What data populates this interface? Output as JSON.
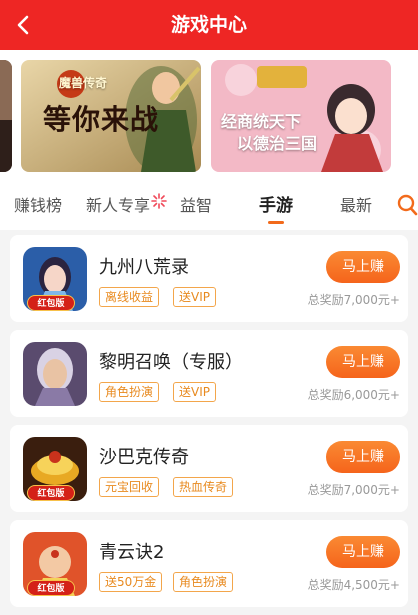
{
  "header": {
    "title": "游戏中心",
    "back_icon": "chevron-left-icon",
    "bg_color": "#ee2624"
  },
  "banners": [
    {
      "title": "等你来战",
      "logo_text": "魔兽传奇"
    },
    {
      "title_line1": "经商统天下",
      "title_line2": "以德治三国"
    }
  ],
  "tabs": [
    {
      "label": "赚钱榜",
      "active": false
    },
    {
      "label": "新人专享",
      "active": false
    },
    {
      "label": "益智",
      "active": false
    },
    {
      "label": "手游",
      "active": true
    },
    {
      "label": "最新",
      "active": false
    }
  ],
  "search_icon": "search-icon",
  "accent_color": "#f26a1b",
  "games": [
    {
      "name": "九州八荒录",
      "tags": [
        "离线收益",
        "送VIP"
      ],
      "button": "马上赚",
      "reward": "总奖励7,000元+",
      "badge": "红包版"
    },
    {
      "name": "黎明召唤（专服）",
      "tags": [
        "角色扮演",
        "送VIP"
      ],
      "button": "马上赚",
      "reward": "总奖励6,000元+",
      "badge": ""
    },
    {
      "name": "沙巴克传奇",
      "tags": [
        "元宝回收",
        "热血传奇"
      ],
      "button": "马上赚",
      "reward": "总奖励7,000元+",
      "badge": "红包版"
    },
    {
      "name": "青云诀2",
      "tags": [
        "送50万金",
        "角色扮演"
      ],
      "button": "马上赚",
      "reward": "总奖励4,500元+",
      "badge": "红包版"
    }
  ]
}
